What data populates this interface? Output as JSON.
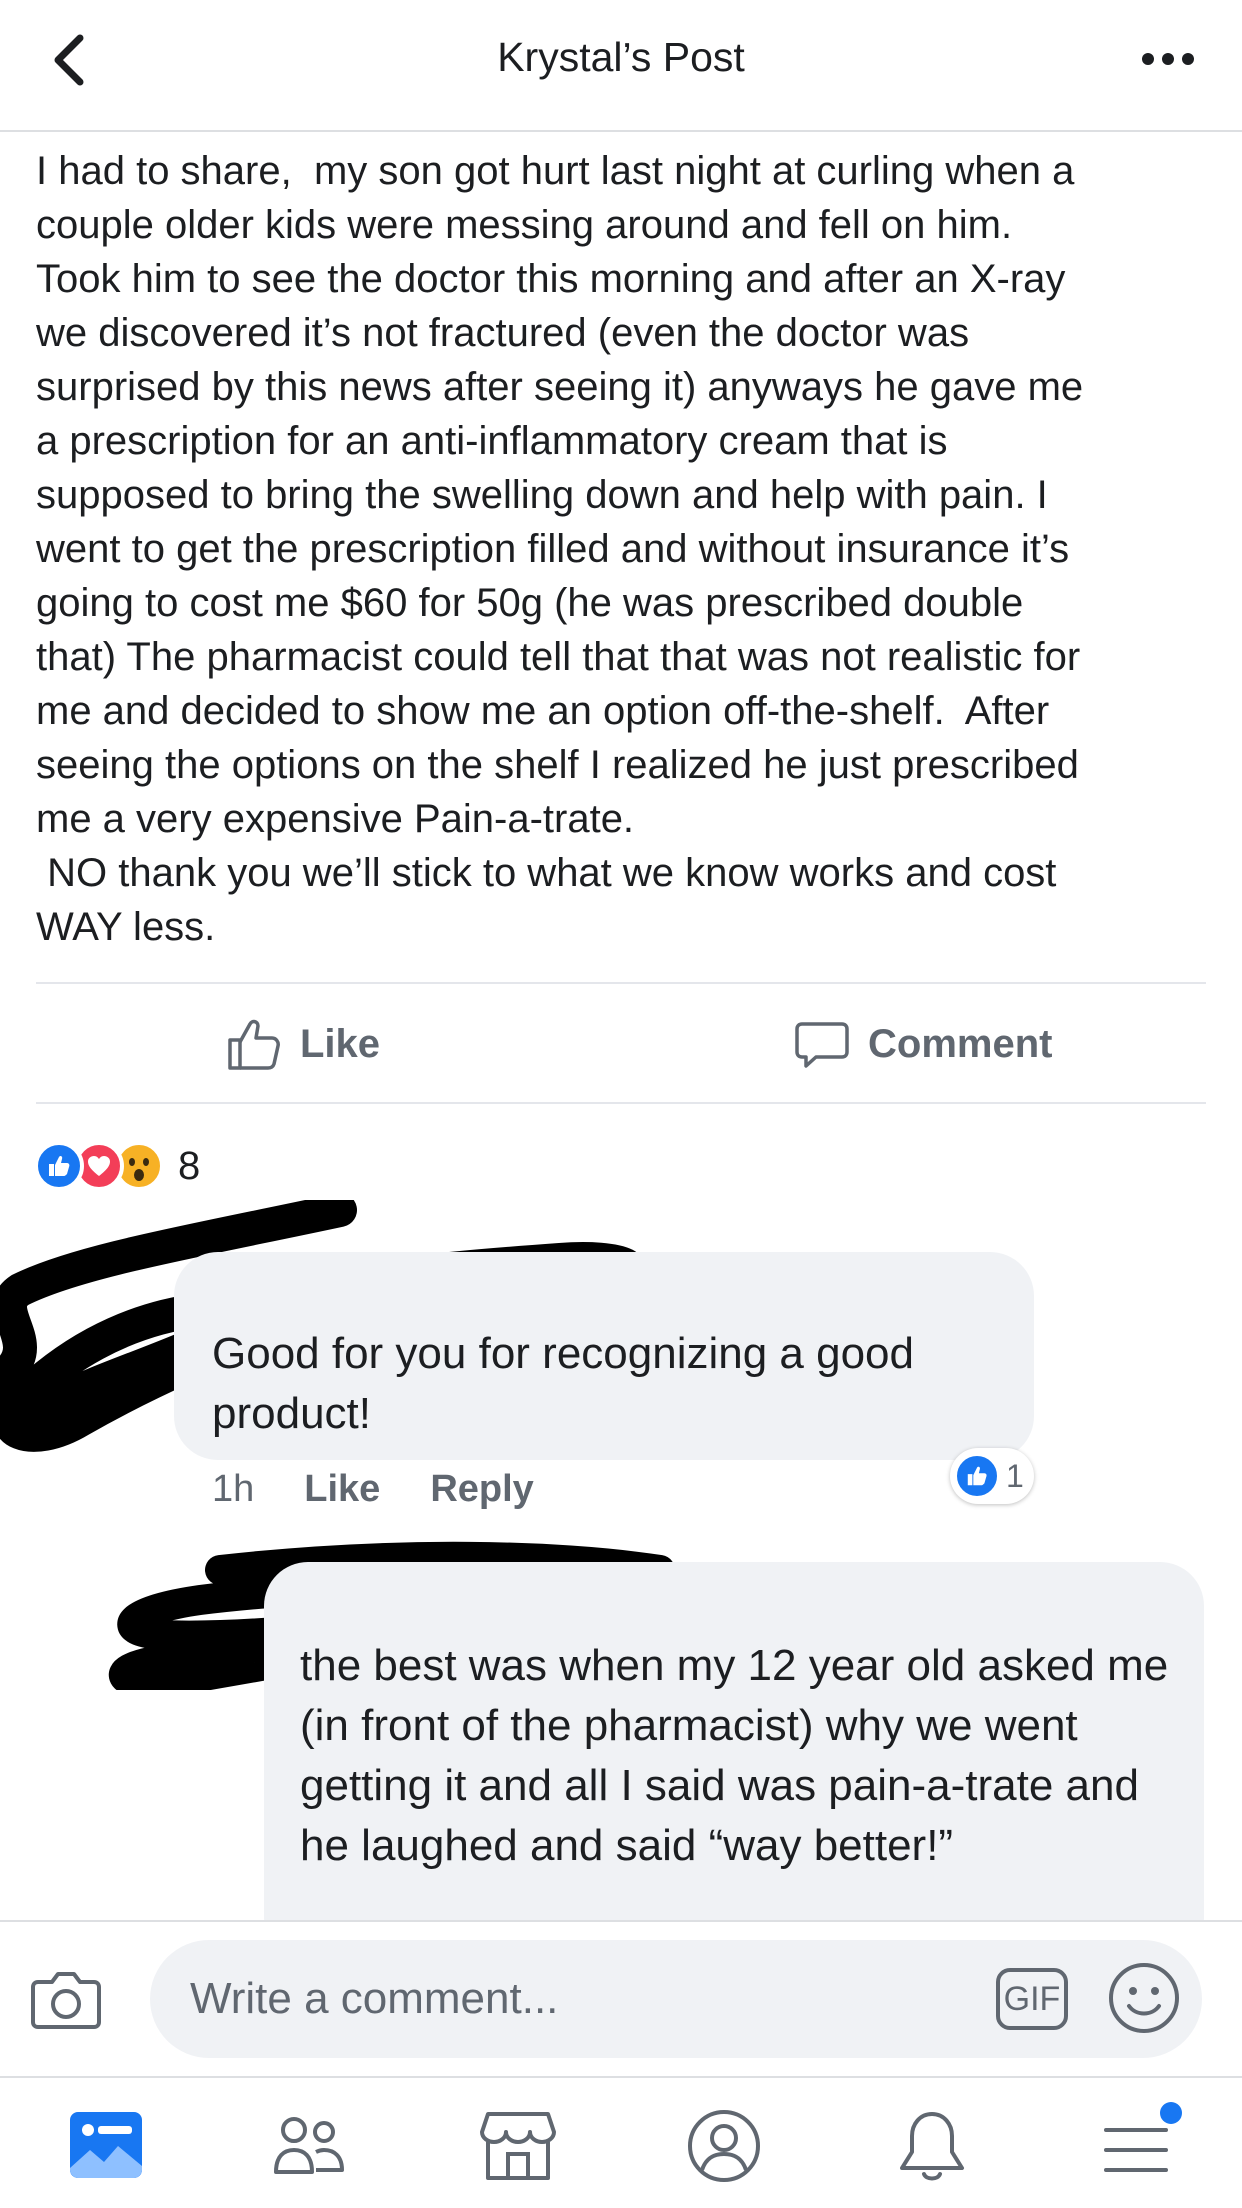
{
  "header": {
    "title": "Krystal’s Post",
    "back_icon": "chevron-left-icon",
    "more_icon": "more-horizontal-icon"
  },
  "post": {
    "text": "I had to share,  my son got hurt last night at curling when a\ncouple older kids were messing around and fell on him.\nTook him to see the doctor this morning and after an X-ray\nwe discovered it’s not fractured (even the doctor was\nsurprised by this news after seeing it) anyways he gave me\na prescription for an anti-inflammatory cream that is\nsupposed to bring the swelling down and help with pain. I\nwent to get the prescription filled and without insurance it’s\ngoing to cost me $60 for 50g (he was prescribed double\nthat) The pharmacist could tell that that was not realistic for\nme and decided to show me an option off-the-shelf.  After\nseeing the options on the shelf I realized he just prescribed\nme a very expensive Pain-a-trate.\n NO thank you we’ll stick to what we know works and cost\nWAY less."
  },
  "actions": {
    "like_label": "Like",
    "comment_label": "Comment"
  },
  "reactions": {
    "types": [
      "like",
      "love",
      "wow"
    ],
    "count": "8"
  },
  "comments": [
    {
      "text": "Good for you for recognizing a good product!",
      "time": "1h",
      "like_label": "Like",
      "reply_label": "Reply",
      "reaction_count": "1"
    },
    {
      "text": "the best was when my 12 year old asked me (in front of the pharmacist) why we went getting it and all I said was pain-a-trate and he laughed and said “way better!”"
    }
  ],
  "composer": {
    "placeholder": "Write a comment...",
    "gif_label": "GIF"
  },
  "bottom_nav": {
    "items": [
      "news-feed-icon",
      "friends-icon",
      "marketplace-icon",
      "profile-icon",
      "notifications-icon",
      "menu-icon"
    ]
  },
  "colors": {
    "accent": "#1877f2",
    "love": "#f33e58",
    "wow": "#f7b125",
    "secondary_text": "#606770",
    "bubble": "#f0f2f5"
  }
}
